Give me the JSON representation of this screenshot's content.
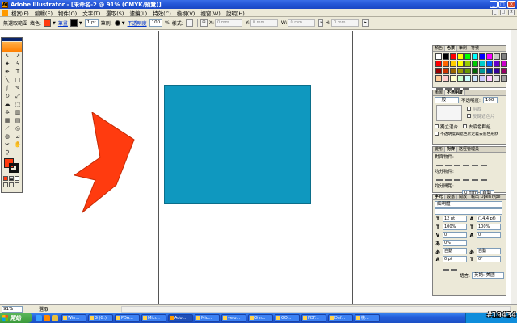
{
  "window": {
    "title": "Adobe Illustrator - [未命名-2 @ 91% (CMYK/預覽)]",
    "controls": [
      "_",
      "□",
      "×"
    ]
  },
  "menu": {
    "items": [
      "檔案(F)",
      "編輯(E)",
      "物件(O)",
      "文字(T)",
      "選取(S)",
      "濾鏡(L)",
      "特效(C)",
      "檢視(V)",
      "視窗(W)",
      "說明(H)"
    ]
  },
  "control_bar": {
    "no_selection": "無選取範圍",
    "fill_label": "填色:",
    "fill_color": "#ff3b0f",
    "stroke_link": "筆畫",
    "stroke_weight": "1 pt",
    "style_label": "筆刷:",
    "opacity_link": "不透明度",
    "opacity_value": "100",
    "percent": "%",
    "style2_label": "樣式:",
    "x_label": "X:",
    "y_label": "Y:",
    "w_label": "W:",
    "h_label": "H:",
    "x_value": "0 mm",
    "y_value": "0 mm",
    "w_value": "0 mm",
    "h_value": "0 mm"
  },
  "canvas": {
    "rect_color": "#0f98bf",
    "shape_color": "#ff3b0f"
  },
  "panels": {
    "swatches": {
      "tabs": [
        "顏色",
        "色票",
        "筆刷",
        "符號"
      ],
      "colors": [
        "#ffffff",
        "#000000",
        "#ff0000",
        "#ffff00",
        "#00ff00",
        "#00ffff",
        "#0000ff",
        "#ff00ff",
        "#c8c8c8",
        "#808080",
        "#ff0000",
        "#ff6600",
        "#ffcc00",
        "#ffff00",
        "#99cc00",
        "#00cc00",
        "#00cccc",
        "#0066ff",
        "#6600cc",
        "#cc00cc",
        "#990000",
        "#cc3300",
        "#996600",
        "#999900",
        "#669900",
        "#006600",
        "#009999",
        "#003399",
        "#330099",
        "#990066",
        "#ffcc99",
        "#ffcccc",
        "#ffffcc",
        "#ccffcc",
        "#ccffff",
        "#cce5ff",
        "#ccccff",
        "#ffccff",
        "#e0e0e0",
        "#a0a0a0"
      ]
    },
    "transparency": {
      "tabs": [
        "漸層",
        "不透明度"
      ],
      "mode": "一般",
      "opacity_label": "不透明度:",
      "opacity_value": "100",
      "clip": "剪裁",
      "invert": "反轉遮色片",
      "isolate": "獨立混合",
      "knockout": "去底色群組",
      "opacity_mask": "不透明度與遮色片定義去底色形狀"
    },
    "align": {
      "tabs": [
        "變形",
        "對齊",
        "路徑管理員"
      ],
      "align_objects": "對齊物件:",
      "distribute_objects": "均分物件:",
      "distribute_spacing": "均分間距:",
      "spacing_value": "0 mm",
      "auto": "自動"
    },
    "character": {
      "tabs": [
        "字元",
        "段落",
        "開放",
        "輸出 OpenType"
      ],
      "font": "細明體",
      "size": "12 pt",
      "leading": "(14.4 pt)",
      "hscale": "100%",
      "vscale": "100%",
      "kerning": "0",
      "tracking": "0",
      "tsume": "0%",
      "rotate": "0°",
      "auto1": "自動",
      "auto2": "自動",
      "baseline": "0 pt",
      "language_label": "語言:",
      "language": "英語: 美國"
    }
  },
  "status": {
    "zoom": "91%",
    "tool": "選取"
  },
  "taskbar": {
    "start": "開始",
    "tasks": [
      "Win...",
      "G (G:)",
      "PDA...",
      "Micr...",
      "Ado...",
      "Mic...",
      "velo...",
      "Gm...",
      "GO...",
      "PDF...",
      "Def...",
      "桃..."
    ],
    "watermark": "#19434"
  }
}
